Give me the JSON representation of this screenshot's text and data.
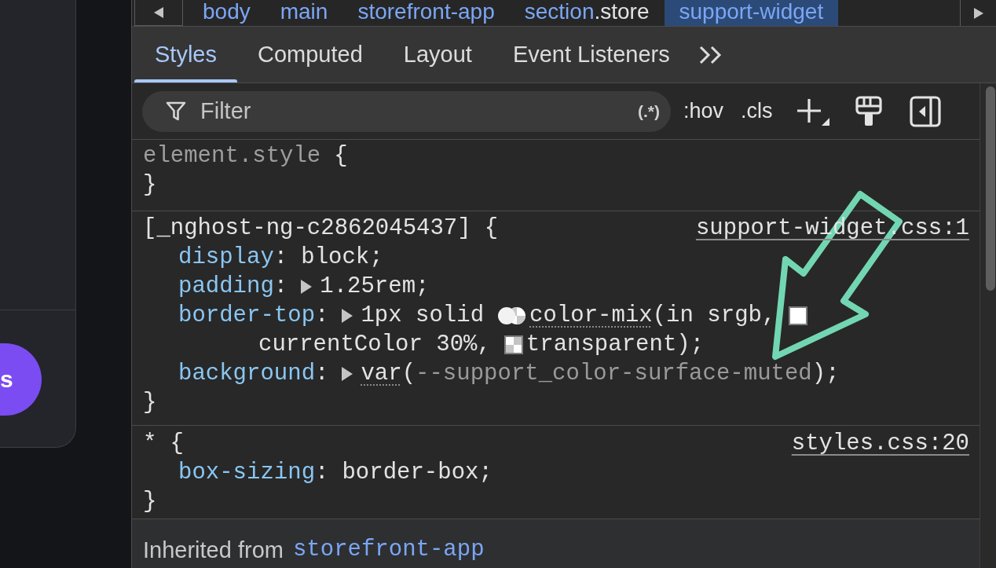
{
  "side_panel": {
    "button": {
      "label": "s"
    }
  },
  "breadcrumbs": [
    {
      "tag": "body",
      "selected": false
    },
    {
      "tag": "main",
      "selected": false
    },
    {
      "tag": "storefront-app",
      "selected": false
    },
    {
      "tag": "section",
      "class_name": ".store",
      "selected": false
    },
    {
      "tag": "support-widget",
      "selected": true
    }
  ],
  "tabs": [
    {
      "label": "Styles",
      "selected": true
    },
    {
      "label": "Computed",
      "selected": false
    },
    {
      "label": "Layout",
      "selected": false
    },
    {
      "label": "Event Listeners",
      "selected": false
    }
  ],
  "filter": {
    "placeholder": "Filter",
    "regex_toggle": "(.*)"
  },
  "toolbar_toggles": [
    ":hov",
    ".cls"
  ],
  "rules": [
    {
      "kind": "inline",
      "selector": "element.style",
      "open": "{",
      "close": "}"
    },
    {
      "kind": "matched",
      "selector": "[_nghost-ng-c2862045437]",
      "open": "{",
      "source": "support-widget.css:1",
      "declarations": [
        {
          "property": "display",
          "separator": ":",
          "expandable": false,
          "lines": [
            [
              {
                "kind": "text",
                "text": "block;"
              }
            ]
          ]
        },
        {
          "property": "padding",
          "separator": ":",
          "expandable": true,
          "lines": [
            [
              {
                "kind": "text",
                "text": "1.25rem;"
              }
            ]
          ]
        },
        {
          "property": "border-top",
          "separator": ":",
          "expandable": true,
          "lines": [
            [
              {
                "kind": "text",
                "text": "1px solid"
              },
              {
                "kind": "mix-swatch"
              },
              {
                "kind": "func",
                "text": "color-mix"
              },
              {
                "kind": "text",
                "text": "(in srgb,"
              },
              {
                "kind": "color-swatch",
                "color": "#ffffff"
              }
            ],
            [
              {
                "kind": "text",
                "text": "currentColor 30%,"
              },
              {
                "kind": "transparent-swatch"
              },
              {
                "kind": "text",
                "text": "transparent);"
              }
            ]
          ]
        },
        {
          "property": "background",
          "separator": ":",
          "expandable": true,
          "lines": [
            [
              {
                "kind": "func",
                "text": "var"
              },
              {
                "kind": "text",
                "text": "("
              },
              {
                "kind": "muted",
                "text": "--support_color-surface-muted"
              },
              {
                "kind": "text",
                "text": ");"
              }
            ]
          ]
        }
      ],
      "close": "}"
    },
    {
      "kind": "matched",
      "selector": "*",
      "open": "{",
      "source": "styles.css:20",
      "declarations": [
        {
          "property": "box-sizing",
          "separator": ":",
          "expandable": false,
          "lines": [
            [
              {
                "kind": "text",
                "text": "border-box;"
              }
            ]
          ]
        }
      ],
      "close": "}"
    }
  ],
  "inherited": {
    "label": "Inherited from",
    "source": "storefront-app"
  }
}
